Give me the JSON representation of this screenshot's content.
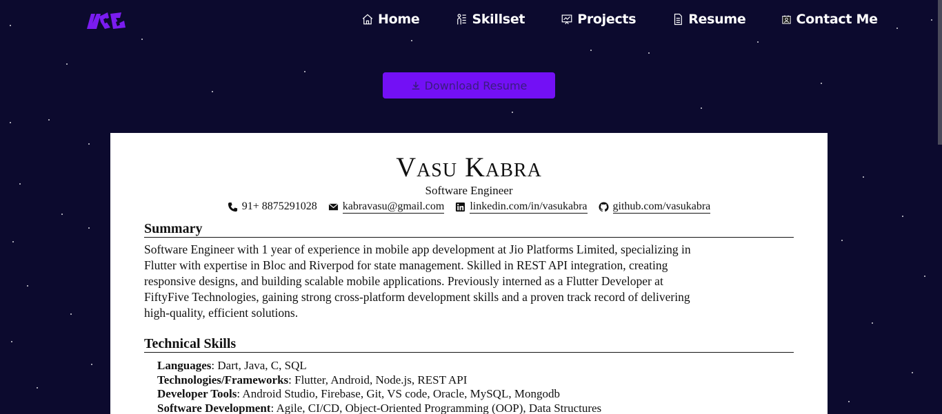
{
  "nav": {
    "items": [
      {
        "label": "Home",
        "icon": "home-icon"
      },
      {
        "label": "Skillset",
        "icon": "skillset-icon"
      },
      {
        "label": "Projects",
        "icon": "projects-icon"
      },
      {
        "label": "Resume",
        "icon": "resume-icon"
      },
      {
        "label": "Contact Me",
        "icon": "contact-icon"
      }
    ]
  },
  "download": {
    "label": "Download Resume"
  },
  "resume": {
    "name": "Vasu Kabra",
    "subtitle": "Software Engineer",
    "phone": "91+ 8875291028",
    "email": "kabravasu@gmail.com",
    "linkedin": "linkedin.com/in/vasukabra",
    "github": "github.com/vasukabra",
    "summary_title": "Summary",
    "summary_lines": [
      "Software Engineer with 1 year of experience in mobile app development at Jio Platforms Limited, specializing in",
      "Flutter with expertise in Bloc and Riverpod for state management. Skilled in REST API integration, creating",
      "responsive designs, and building scalable mobile applications. Previously interned as a Flutter Developer at",
      "FiftyFive Technologies, gaining strong cross-platform development skills and a proven track record of delivering",
      "high-quality, efficient solutions."
    ],
    "skills_title": "Technical Skills",
    "skills": [
      {
        "label": "Languages",
        "value": ": Dart, Java, C, SQL"
      },
      {
        "label": "Technologies/Frameworks",
        "value": ": Flutter, Android, Node.js, REST API"
      },
      {
        "label": "Developer Tools",
        "value": ": Android Studio, Firebase, Git, VS code, Oracle, MySQL, Mongodb"
      },
      {
        "label": "Software Development",
        "value": ": Agile, CI/CD, Object-Oriented Programming (OOP), Data Structures"
      }
    ]
  },
  "colors": {
    "background": "#0c0a2e",
    "accent": "#7310f5",
    "paper": "#ffffff"
  }
}
